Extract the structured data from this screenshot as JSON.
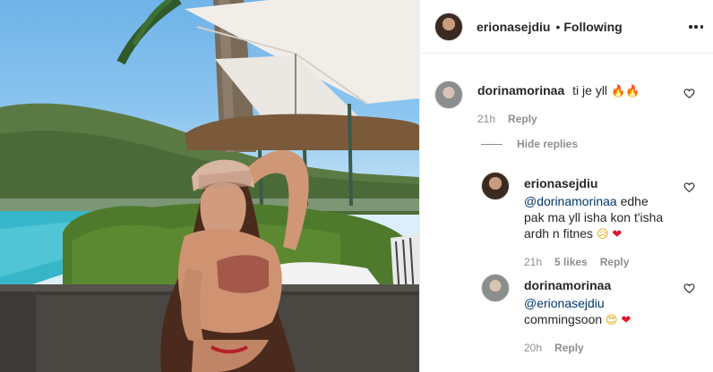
{
  "post": {
    "author": "erionasejdiu",
    "follow_status": "Following",
    "separator": "•"
  },
  "comments": [
    {
      "username": "dorinamorinaa",
      "text": "ti je yll",
      "emoji": "🔥🔥",
      "time": "21h",
      "reply_label": "Reply"
    }
  ],
  "replies_toggle": "Hide replies",
  "replies": [
    {
      "username": "erionasejdiu",
      "mention": "@dorinamorinaa",
      "line1_rest": " edhe",
      "line2": "pak ma yll isha kon t'isha",
      "line3": "ardh n fitnes",
      "emoji_sad": "😥",
      "emoji_heart": "❤",
      "time": "21h",
      "likes": "5 likes",
      "reply_label": "Reply"
    },
    {
      "username": "dorinamorinaa",
      "mention": "@erionasejdiu",
      "text": "commingsoon",
      "emoji_love": "😍",
      "emoji_heart": "❤",
      "time": "20h",
      "reply_label": "Reply"
    }
  ],
  "icons": {
    "more": "more-horizontal-icon",
    "like": "heart-outline-icon"
  },
  "colors": {
    "text": "#262626",
    "muted": "#8e8e8e",
    "mention": "#00376b",
    "heart": "#e0162b"
  }
}
